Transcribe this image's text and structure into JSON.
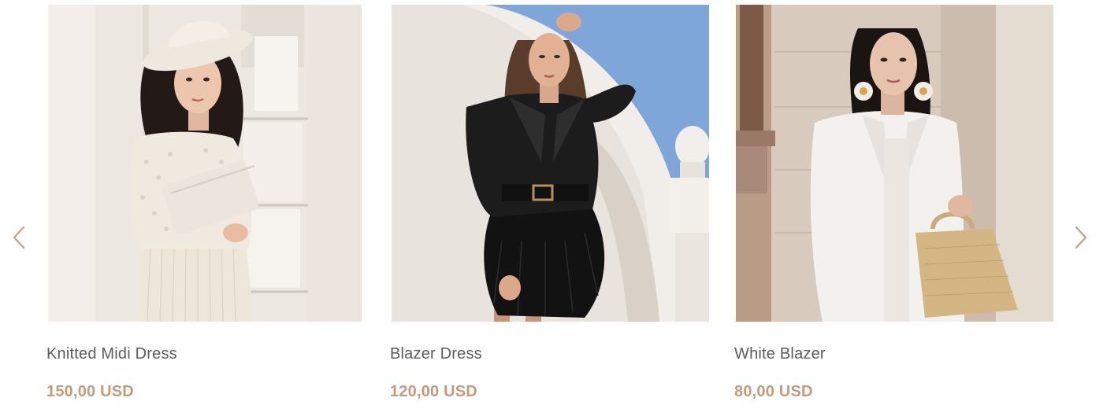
{
  "carousel": {
    "prev_icon": "chevron-left-icon",
    "next_icon": "chevron-right-icon",
    "products": [
      {
        "name": "Knitted Midi Dress",
        "price": "150,00 USD",
        "image_subject": "woman in white hat and cream knit dress holding clutch"
      },
      {
        "name": "Blazer Dress",
        "price": "120,00 USD",
        "image_subject": "woman in black blazer dress with feather skirt and gold belt"
      },
      {
        "name": "White Blazer",
        "price": "80,00 USD",
        "image_subject": "woman in white blazer holding gold handbag"
      }
    ]
  },
  "colors": {
    "name_text": "#5c5c5c",
    "price_accent": "#c49a7c",
    "arrow": "#c2a085"
  }
}
